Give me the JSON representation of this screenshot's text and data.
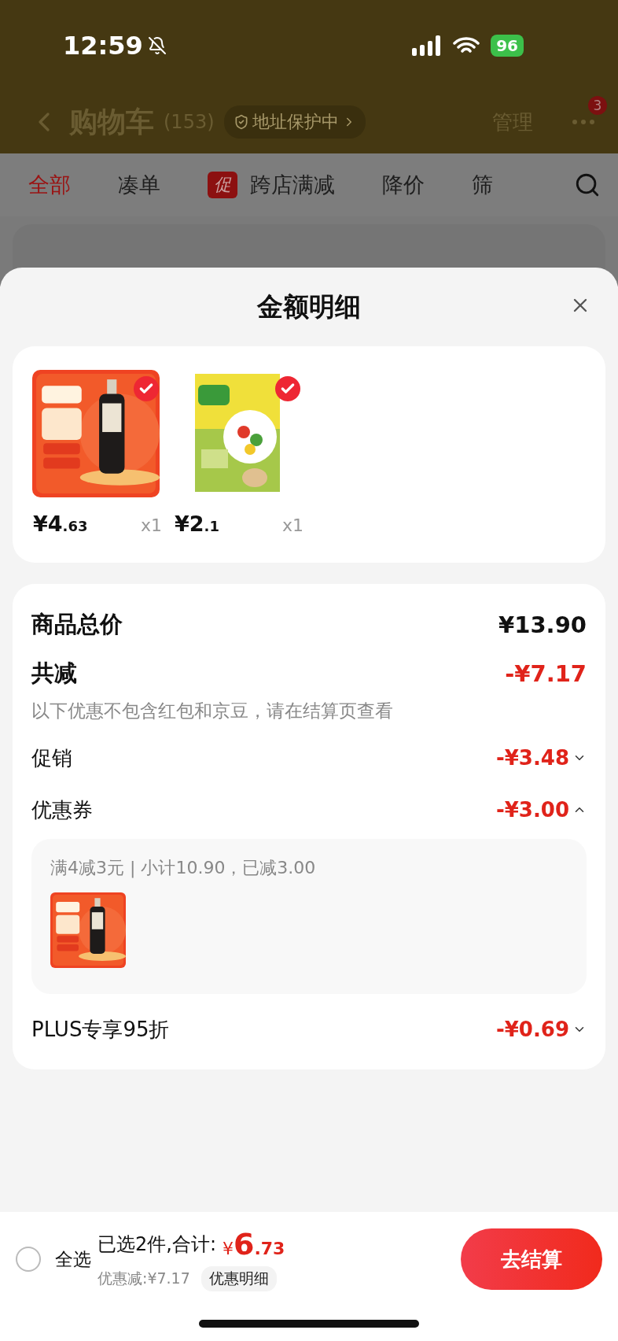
{
  "status_bar": {
    "time": "12:59",
    "battery": "96"
  },
  "nav": {
    "title": "购物车",
    "count": "(153)",
    "address_badge": "地址保护中",
    "manage": "管理",
    "more_badge": "3"
  },
  "tabs": [
    {
      "label": "全部",
      "selected": true
    },
    {
      "label": "凑单",
      "selected": false
    },
    {
      "label": "跨店满减",
      "selected": false,
      "tag": "促"
    },
    {
      "label": "降价",
      "selected": false
    },
    {
      "label": "筛",
      "selected": false
    }
  ],
  "sheet": {
    "title": "金额明细",
    "products": [
      {
        "kind": "bottle",
        "price_main": "¥4",
        "price_decimal": ".63",
        "quantity": "x1",
        "checked": true
      },
      {
        "kind": "bag",
        "price_main": "¥2",
        "price_decimal": ".1",
        "quantity": "x1",
        "checked": true
      }
    ],
    "total": {
      "label": "商品总价",
      "amount": "¥13.90"
    },
    "reduction": {
      "label": "共减",
      "amount": "-¥7.17",
      "note": "以下优惠不包含红包和京豆，请在结算页查看"
    },
    "discounts": [
      {
        "label": "促销",
        "amount": "-¥3.48",
        "expanded": false
      },
      {
        "label": "优惠券",
        "amount": "-¥3.00",
        "expanded": true,
        "detail": {
          "text": "满4减3元 | 小计10.90，已减3.00",
          "products": [
            {
              "kind": "bottle"
            }
          ]
        }
      },
      {
        "label": "PLUS专享95折",
        "amount": "-¥0.69",
        "expanded": false
      }
    ]
  },
  "bottom_bar": {
    "select_all": {
      "label": "全选",
      "checked": false
    },
    "selected_text": "已选2件,合计:",
    "total_currency": "¥",
    "total_main": "6",
    "total_decimal": ".73",
    "discount": "优惠减:¥7.17",
    "detail_button": "优惠明细",
    "checkout": "去结算"
  }
}
